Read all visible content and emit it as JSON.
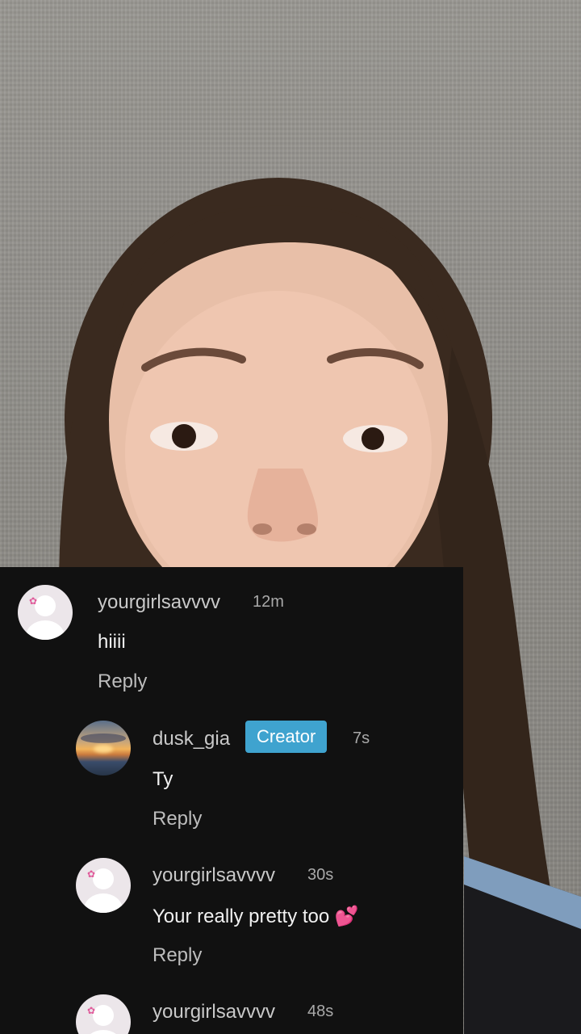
{
  "comments": [
    {
      "username": "yourgirlsavvvv",
      "time": "12m",
      "text": "hiiii",
      "reply_label": "Reply",
      "avatar_icon": "default-profile-with-flower-icon"
    },
    {
      "username": "dusk_gia",
      "badge": "Creator",
      "time": "7s",
      "text": "Ty",
      "reply_label": "Reply",
      "avatar_icon": "sunset-photo-avatar"
    },
    {
      "username": "yourgirlsavvvv",
      "time": "30s",
      "text": "Your really pretty too 💕",
      "reply_label": "Reply",
      "avatar_icon": "default-profile-with-flower-icon"
    },
    {
      "username": "yourgirlsavvvv",
      "time": "48s",
      "avatar_icon": "default-profile-with-flower-icon"
    }
  ],
  "colors": {
    "panel_bg": "#111111",
    "creator_badge": "#3fa3cf",
    "username": "#c9c9c9",
    "comment_text": "#f1f1f1"
  }
}
